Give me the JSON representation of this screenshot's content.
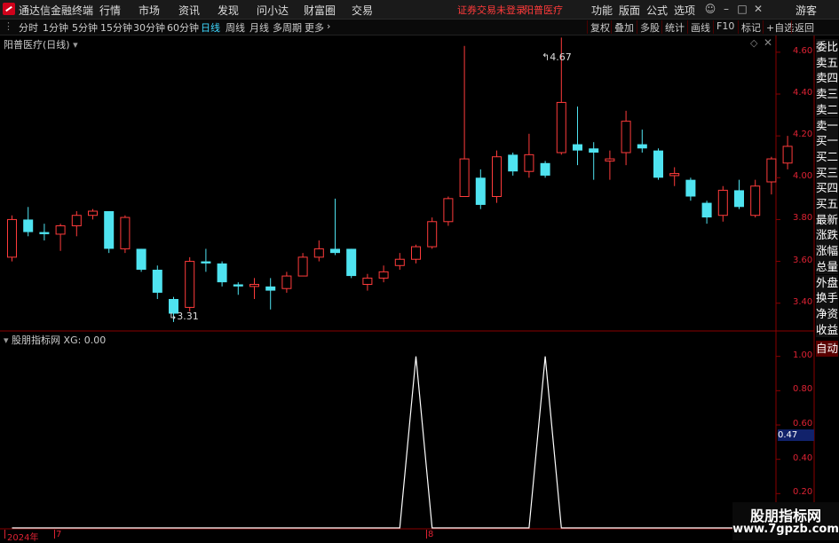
{
  "app": {
    "name": "通达信金融终端"
  },
  "menu": {
    "items": [
      "行情",
      "市场",
      "资讯",
      "发现",
      "问小达",
      "财富圈",
      "交易"
    ]
  },
  "header_notice": {
    "warning": "证券交易未登录",
    "stock_name": "阳普医疗"
  },
  "top_right": {
    "items": [
      "功能",
      "版面",
      "公式",
      "选项"
    ],
    "guest": "游客"
  },
  "toolbar": {
    "periods": [
      "分时",
      "1分钟",
      "5分钟",
      "15分钟",
      "30分钟",
      "60分钟",
      "日线",
      "周线",
      "月线",
      "多周期",
      "更多"
    ],
    "active_period": "日线",
    "right_buttons": [
      "复权",
      "叠加",
      "多股",
      "统计",
      "画线",
      "F10",
      "标记",
      "+自选",
      "返回"
    ]
  },
  "main_chart": {
    "title": "阳普医疗(日线)",
    "high_label": "4.67",
    "low_label": "3.31",
    "y_ticks": [
      "4.60",
      "4.40",
      "4.20",
      "4.00",
      "3.80",
      "3.60",
      "3.40"
    ]
  },
  "indicator": {
    "title": "股朋指标网",
    "value_label": "XG: 0.00",
    "y_ticks": [
      "1.00",
      "0.80",
      "0.60",
      "0.40",
      "0.20"
    ],
    "current_value": "0.47"
  },
  "x_axis": {
    "year": "2024年",
    "marks": [
      "7",
      "8"
    ]
  },
  "sidebar": {
    "items": [
      "委比",
      "卖五",
      "卖四",
      "卖三",
      "卖二",
      "卖一",
      "买一",
      "买二",
      "买三",
      "买四",
      "买五",
      "最新",
      "涨跌",
      "涨幅",
      "总量",
      "外盘",
      "换手",
      "净资",
      "收益"
    ],
    "auto_label": "自动"
  },
  "watermark": {
    "title": "股朋指标网",
    "url": "www.7gpzb.com"
  },
  "colors": {
    "up": "#ff3b3b",
    "down": "#4fe3f0",
    "axis": "#7a0000",
    "active": "#3fd8ff"
  },
  "chart_data": [
    {
      "type": "candlestick",
      "title": "阳普医疗(日线)",
      "ylim": [
        3.28,
        4.68
      ],
      "candles": [
        {
          "o": 3.62,
          "c": 3.8,
          "h": 3.82,
          "l": 3.6
        },
        {
          "o": 3.8,
          "c": 3.74,
          "h": 3.86,
          "l": 3.72
        },
        {
          "o": 3.74,
          "c": 3.73,
          "h": 3.78,
          "l": 3.7
        },
        {
          "o": 3.73,
          "c": 3.77,
          "h": 3.78,
          "l": 3.65
        },
        {
          "o": 3.77,
          "c": 3.82,
          "h": 3.84,
          "l": 3.72
        },
        {
          "o": 3.82,
          "c": 3.84,
          "h": 3.85,
          "l": 3.8
        },
        {
          "o": 3.84,
          "c": 3.66,
          "h": 3.84,
          "l": 3.64
        },
        {
          "o": 3.66,
          "c": 3.81,
          "h": 3.82,
          "l": 3.64
        },
        {
          "o": 3.66,
          "c": 3.56,
          "h": 3.66,
          "l": 3.55
        },
        {
          "o": 3.56,
          "c": 3.45,
          "h": 3.58,
          "l": 3.42
        },
        {
          "o": 3.42,
          "c": 3.35,
          "h": 3.43,
          "l": 3.31
        },
        {
          "o": 3.38,
          "c": 3.6,
          "h": 3.62,
          "l": 3.36
        },
        {
          "o": 3.6,
          "c": 3.59,
          "h": 3.66,
          "l": 3.55
        },
        {
          "o": 3.59,
          "c": 3.5,
          "h": 3.6,
          "l": 3.48
        },
        {
          "o": 3.49,
          "c": 3.48,
          "h": 3.5,
          "l": 3.44
        },
        {
          "o": 3.48,
          "c": 3.49,
          "h": 3.52,
          "l": 3.42
        },
        {
          "o": 3.48,
          "c": 3.46,
          "h": 3.52,
          "l": 3.37
        },
        {
          "o": 3.47,
          "c": 3.53,
          "h": 3.55,
          "l": 3.45
        },
        {
          "o": 3.53,
          "c": 3.62,
          "h": 3.64,
          "l": 3.53
        },
        {
          "o": 3.62,
          "c": 3.66,
          "h": 3.7,
          "l": 3.6
        },
        {
          "o": 3.66,
          "c": 3.64,
          "h": 3.9,
          "l": 3.63
        },
        {
          "o": 3.66,
          "c": 3.53,
          "h": 3.66,
          "l": 3.52
        },
        {
          "o": 3.49,
          "c": 3.52,
          "h": 3.54,
          "l": 3.46
        },
        {
          "o": 3.52,
          "c": 3.55,
          "h": 3.58,
          "l": 3.5
        },
        {
          "o": 3.58,
          "c": 3.61,
          "h": 3.64,
          "l": 3.56
        },
        {
          "o": 3.61,
          "c": 3.67,
          "h": 3.68,
          "l": 3.59
        },
        {
          "o": 3.67,
          "c": 3.79,
          "h": 3.81,
          "l": 3.66
        },
        {
          "o": 3.79,
          "c": 3.9,
          "h": 3.91,
          "l": 3.77
        },
        {
          "o": 3.91,
          "c": 4.09,
          "h": 4.63,
          "l": 3.92
        },
        {
          "o": 4.0,
          "c": 3.87,
          "h": 4.04,
          "l": 3.85
        },
        {
          "o": 3.91,
          "c": 4.1,
          "h": 4.13,
          "l": 3.88
        },
        {
          "o": 4.11,
          "c": 4.03,
          "h": 4.12,
          "l": 4.01
        },
        {
          "o": 4.03,
          "c": 4.11,
          "h": 4.21,
          "l": 4.0
        },
        {
          "o": 4.07,
          "c": 4.01,
          "h": 4.08,
          "l": 4.0
        },
        {
          "o": 4.12,
          "c": 4.36,
          "h": 4.67,
          "l": 4.11
        },
        {
          "o": 4.16,
          "c": 4.13,
          "h": 4.34,
          "l": 4.06
        },
        {
          "o": 4.14,
          "c": 4.12,
          "h": 4.17,
          "l": 3.99
        },
        {
          "o": 4.08,
          "c": 4.09,
          "h": 4.13,
          "l": 3.99
        },
        {
          "o": 4.12,
          "c": 4.27,
          "h": 4.32,
          "l": 4.06
        },
        {
          "o": 4.16,
          "c": 4.14,
          "h": 4.23,
          "l": 4.12
        },
        {
          "o": 4.13,
          "c": 4.0,
          "h": 4.14,
          "l": 3.99
        },
        {
          "o": 4.01,
          "c": 4.02,
          "h": 4.05,
          "l": 3.96
        },
        {
          "o": 3.99,
          "c": 3.91,
          "h": 4.0,
          "l": 3.89
        },
        {
          "o": 3.88,
          "c": 3.81,
          "h": 3.89,
          "l": 3.78
        },
        {
          "o": 3.82,
          "c": 3.94,
          "h": 3.96,
          "l": 3.79
        },
        {
          "o": 3.94,
          "c": 3.86,
          "h": 3.99,
          "l": 3.85
        },
        {
          "o": 3.82,
          "c": 3.96,
          "h": 3.99,
          "l": 3.81
        },
        {
          "o": 3.98,
          "c": 4.09,
          "h": 4.1,
          "l": 3.92
        },
        {
          "o": 4.07,
          "c": 4.15,
          "h": 4.2,
          "l": 4.04
        }
      ]
    },
    {
      "type": "line",
      "title": "股朋指标网",
      "series": [
        {
          "name": "XG",
          "peaks_at_index": [
            25,
            33
          ]
        }
      ],
      "ylim": [
        0,
        1.05
      ],
      "count": 49
    }
  ]
}
